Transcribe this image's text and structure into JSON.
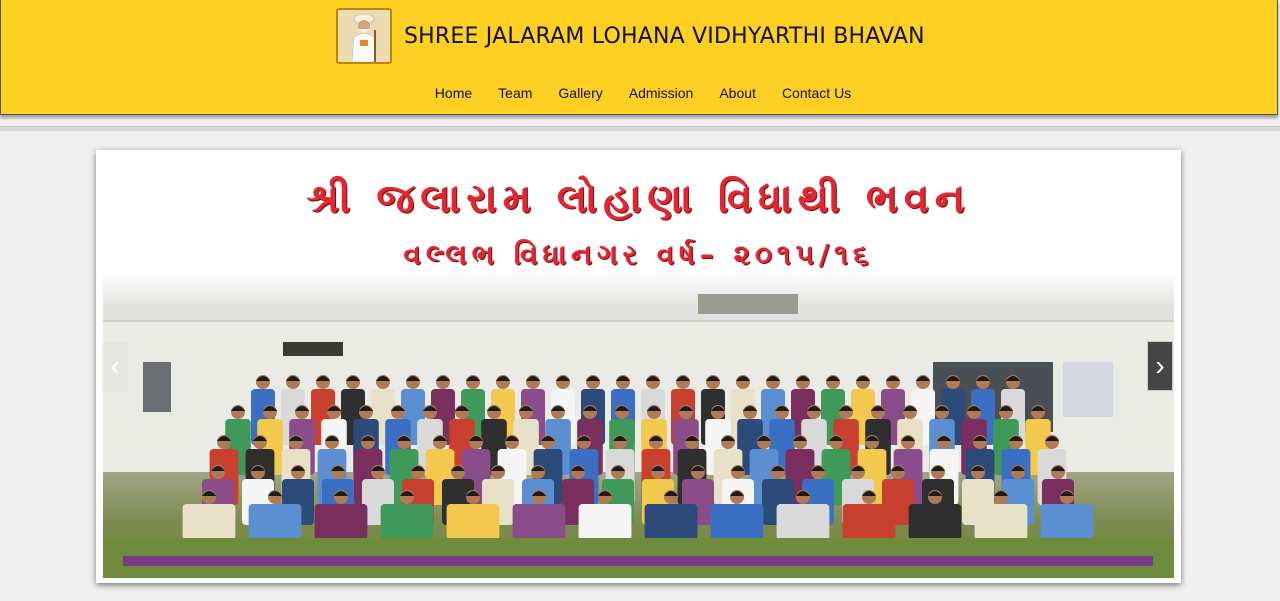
{
  "header": {
    "title": "SHREE JALARAM LOHANA VIDHYARTHI BHAVAN",
    "logo_icon": "jalaram-bapa-portrait-icon",
    "background_color": "#fdd023"
  },
  "nav": {
    "items": [
      {
        "label": "Home"
      },
      {
        "label": "Team"
      },
      {
        "label": "Gallery"
      },
      {
        "label": "Admission"
      },
      {
        "label": "About"
      },
      {
        "label": "Contact Us"
      }
    ]
  },
  "slider": {
    "banner_line1": "શ્રી જલારામ લોહાણા વિધાથી ભવન",
    "banner_line2": "વલ્લભ વિધાનગર વર્ષ– ૨૦૧૫/૧૬",
    "banner_text_color": "#e3262f",
    "prev_label": "‹",
    "next_label": "›",
    "prev_icon": "chevron-left-icon",
    "next_icon": "chevron-right-icon"
  }
}
